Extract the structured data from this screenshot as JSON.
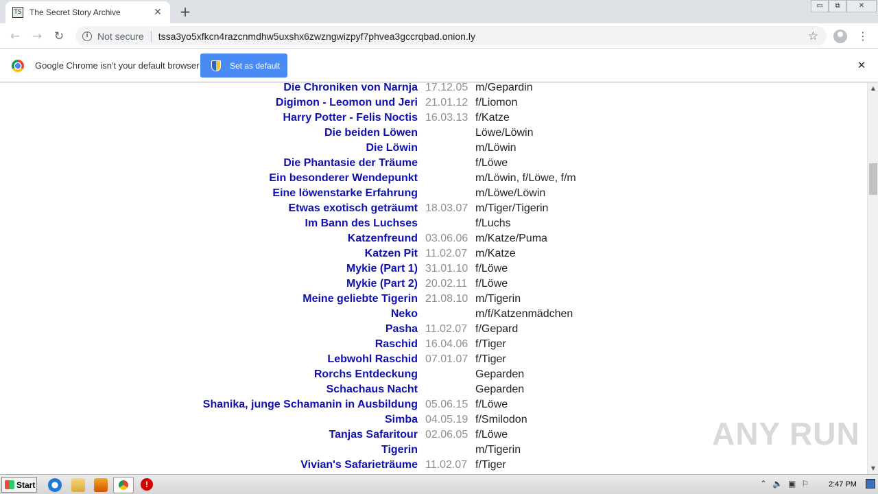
{
  "browser": {
    "tab_title": "The Secret Story Archive",
    "tab_favicon_text": "TS",
    "new_tab": "+",
    "tab_close": "✕",
    "window_controls": {
      "minimize": "▭",
      "restore": "⧉",
      "close": "✕"
    },
    "security_label": "Not secure",
    "url": "tssa3yo5xfkcn4razcnmdhw5uxshx6zwzngwizpyf7phvea3gccrqbad.onion.ly"
  },
  "infobar": {
    "message": "Google Chrome isn't your default browser",
    "button_label": "Set as default",
    "close": "✕"
  },
  "stories": [
    {
      "title": "Die Chroniken von Narnja",
      "date": "17.12.05",
      "species": "m/Gepardin"
    },
    {
      "title": "Digimon - Leomon und Jeri",
      "date": "21.01.12",
      "species": "f/Liomon"
    },
    {
      "title": "Harry Potter - Felis Noctis",
      "date": "16.03.13",
      "species": "f/Katze"
    },
    {
      "title": "Die beiden Löwen",
      "date": "",
      "species": "Löwe/Löwin"
    },
    {
      "title": "Die Löwin",
      "date": "",
      "species": "m/Löwin"
    },
    {
      "title": "Die Phantasie der Träume",
      "date": "",
      "species": "f/Löwe"
    },
    {
      "title": "Ein besonderer Wendepunkt",
      "date": "",
      "species": "m/Löwin, f/Löwe, f/m"
    },
    {
      "title": "Eine löwenstarke Erfahrung",
      "date": "",
      "species": "m/Löwe/Löwin"
    },
    {
      "title": "Etwas exotisch geträumt",
      "date": "18.03.07",
      "species": "m/Tiger/Tigerin"
    },
    {
      "title": "Im Bann des Luchses",
      "date": "",
      "species": "f/Luchs"
    },
    {
      "title": "Katzenfreund",
      "date": "03.06.06",
      "species": "m/Katze/Puma"
    },
    {
      "title": "Katzen Pit",
      "date": "11.02.07",
      "species": "m/Katze"
    },
    {
      "title": "Mykie (Part 1)",
      "date": "31.01.10",
      "species": "f/Löwe"
    },
    {
      "title": "Mykie (Part 2)",
      "date": "20.02.11",
      "species": "f/Löwe"
    },
    {
      "title": "Meine geliebte Tigerin",
      "date": "21.08.10",
      "species": "m/Tigerin"
    },
    {
      "title": "Neko",
      "date": "",
      "species": "m/f/Katzenmädchen"
    },
    {
      "title": "Pasha",
      "date": "11.02.07",
      "species": "f/Gepard"
    },
    {
      "title": "Raschid",
      "date": "16.04.06",
      "species": "f/Tiger"
    },
    {
      "title": "Lebwohl Raschid",
      "date": "07.01.07",
      "species": "f/Tiger"
    },
    {
      "title": "Rorchs Entdeckung",
      "date": "",
      "species": "Geparden"
    },
    {
      "title": "Schachaus Nacht",
      "date": "",
      "species": "Geparden"
    },
    {
      "title": "Shanika, junge Schamanin in Ausbildung",
      "date": "05.06.15",
      "species": "f/Löwe"
    },
    {
      "title": "Simba",
      "date": "04.05.19",
      "species": "f/Smilodon"
    },
    {
      "title": "Tanjas Safaritour",
      "date": "02.06.05",
      "species": "f/Löwe"
    },
    {
      "title": "Tigerin",
      "date": "",
      "species": "m/Tigerin"
    },
    {
      "title": "Vivian's Safarieträume",
      "date": "11.02.07",
      "species": "f/Tiger"
    }
  ],
  "watermark": "ANY RUN",
  "taskbar": {
    "start_label": "Start",
    "clock": "2:47 PM"
  },
  "colors": {
    "link": "#1010b0",
    "date": "#909090",
    "button": "#4a8af4"
  }
}
